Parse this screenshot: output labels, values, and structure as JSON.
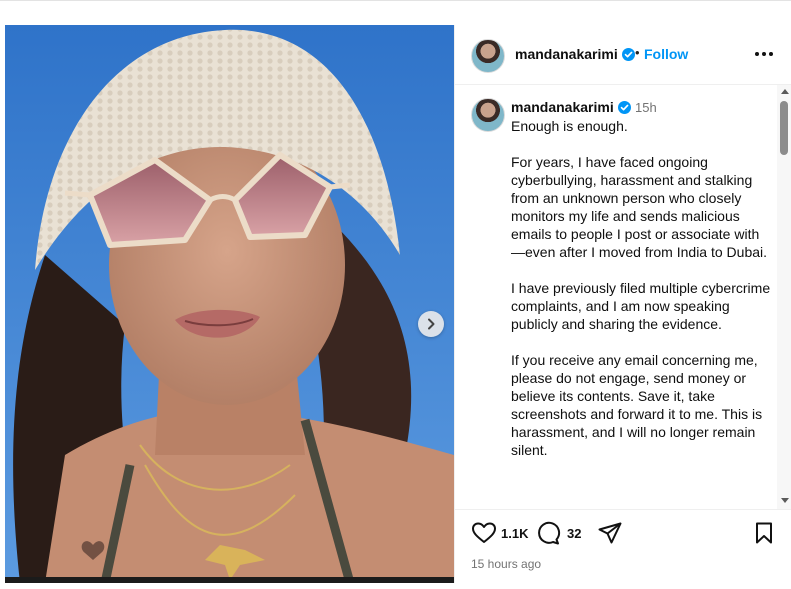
{
  "post": {
    "username": "mandanakarimi",
    "follow_label": "Follow",
    "separator": "•",
    "caption_time": "15h",
    "caption": "Enough is enough.\n\nFor years, I have faced ongoing cyberbullying, harassment and stalking from an unknown person who closely monitors my life and sends malicious emails to people I post or associate with—even after I moved from India to Dubai.\n\nI have previously filed multiple cybercrime complaints, and I am now speaking publicly and sharing the evidence.\n\nIf you receive any email concerning me, please do not engage, send money or believe its contents. Save it, take screenshots and forward it to me. This is harassment, and I will no longer remain silent.",
    "likes": "1.1K",
    "comments": "32",
    "time_ago": "15 hours ago"
  },
  "icons": {
    "verified": "verified-badge-icon",
    "more": "more-options-icon",
    "like": "heart-icon",
    "comment": "comment-bubble-icon",
    "share": "paper-plane-icon",
    "save": "bookmark-icon",
    "next": "chevron-right-icon"
  },
  "colors": {
    "accent": "#0095f6",
    "verified": "#0095f6",
    "secondary_text": "#737373"
  }
}
